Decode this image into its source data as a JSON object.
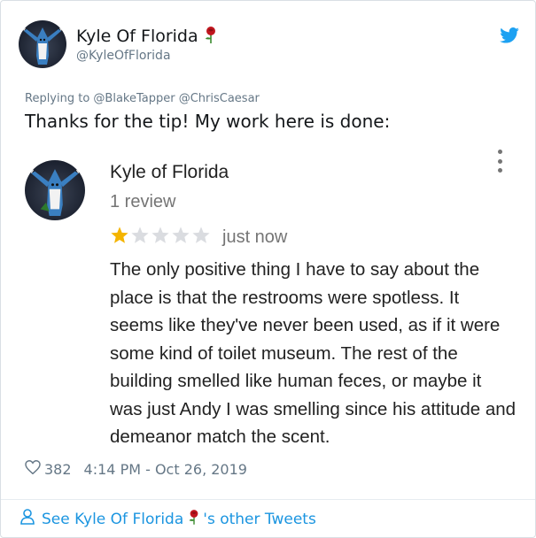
{
  "tweet": {
    "author_name": "Kyle Of Florida",
    "author_handle": "@KyleOfFlorida",
    "replying_to": "Replying to @BlakeTapper @ChrisCaesar",
    "text": "Thanks for the tip! My work here is done:",
    "likes": "382",
    "timestamp": "4:14 PM - Oct 26, 2019",
    "see_more_prefix": "See Kyle Of Florida",
    "see_more_suffix": "'s other Tweets"
  },
  "review": {
    "reviewer_name": "Kyle of Florida",
    "review_count": "1 review",
    "rating": 1,
    "rating_max": 5,
    "time": "just now",
    "body": "The only positive thing I have to say about the place is that the restrooms were spotless. It seems like they've never been used, as if it were some kind of toilet museum. The rest of the building smelled like human feces, or maybe it was just Andy I was smelling since his attitude and demeanor match the scent."
  },
  "colors": {
    "twitter_blue": "#1da1f2",
    "link_blue": "#1b95e0",
    "star_filled": "#f4b400",
    "star_empty": "#dadce0",
    "rose_red": "#c0161e"
  },
  "icons": [
    "avatar-shark",
    "rose-emoji",
    "twitter-bird-icon",
    "kebab-menu-icon",
    "star-icon",
    "heart-icon",
    "person-icon"
  ]
}
